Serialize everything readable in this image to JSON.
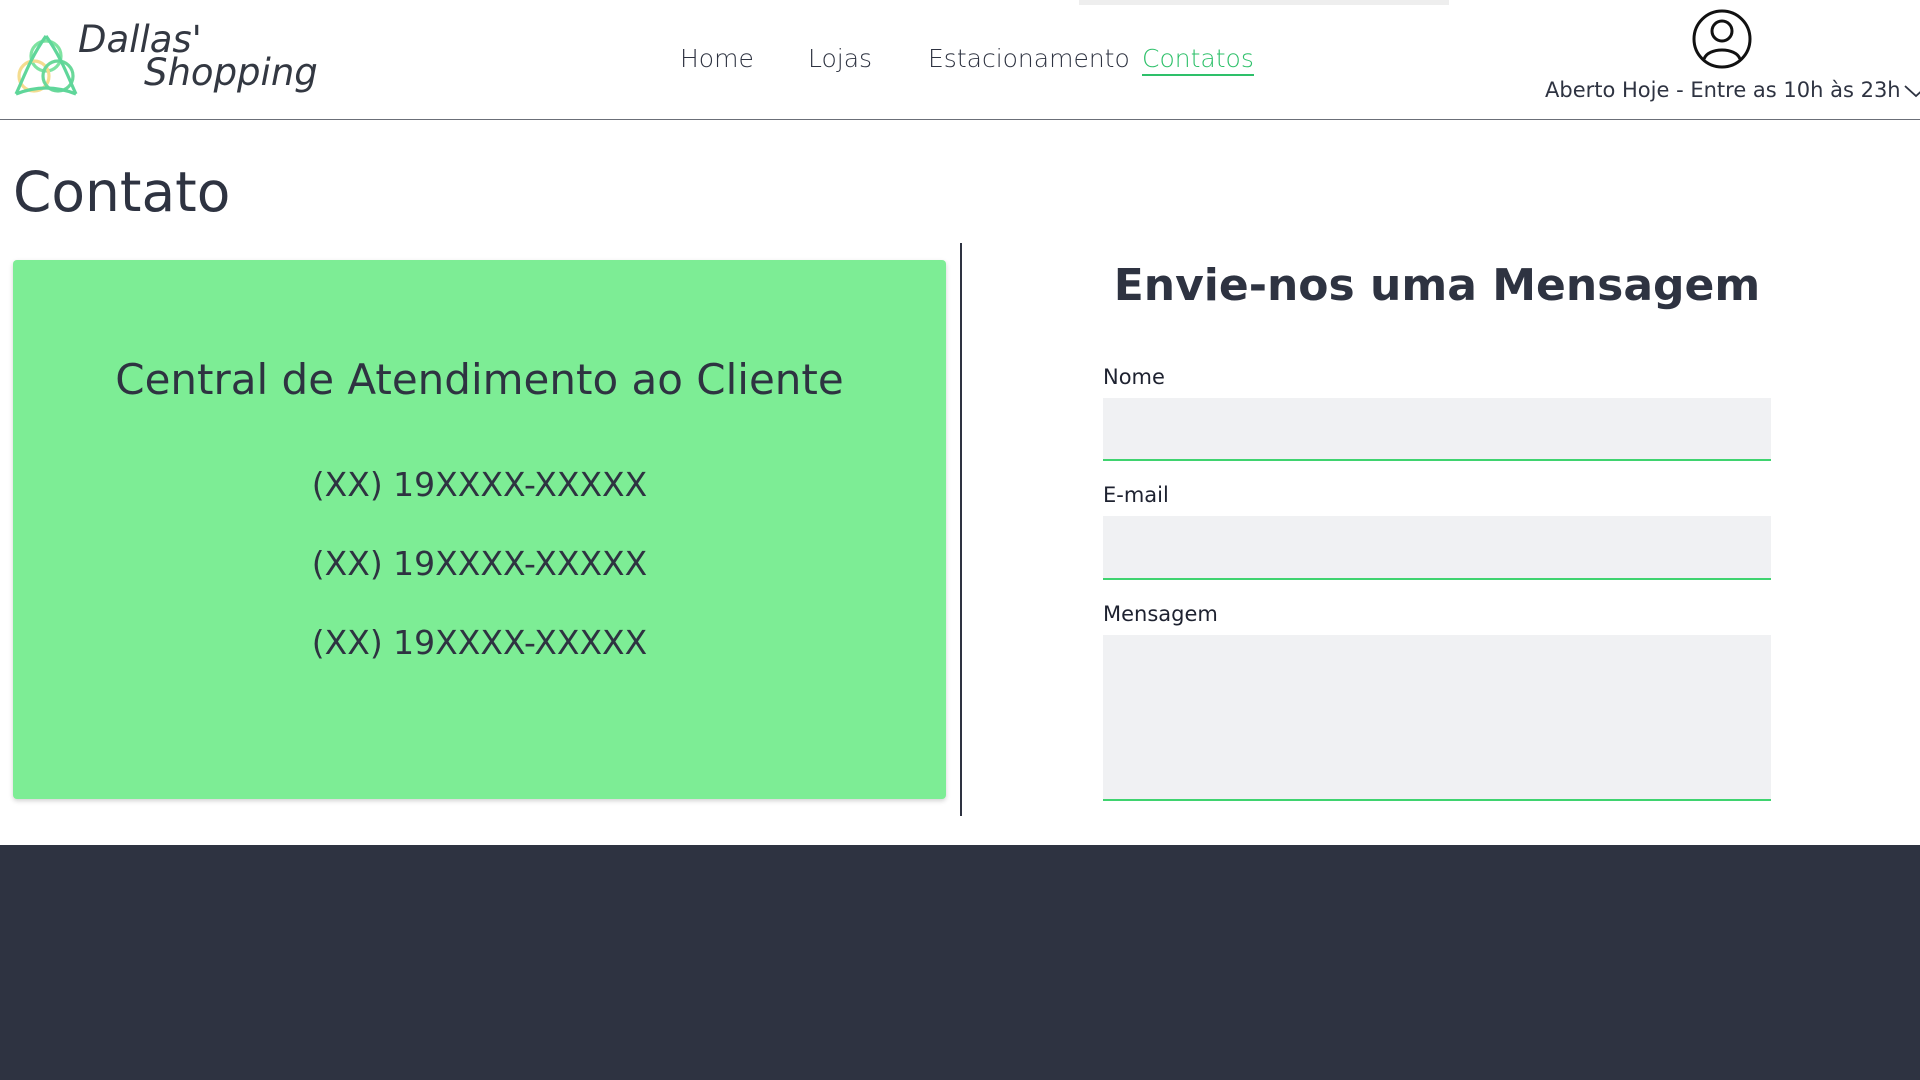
{
  "brand": {
    "line1": "Dallas'",
    "line2": "Shopping",
    "logo_icon": "triquetra-icon"
  },
  "nav": {
    "items": [
      {
        "label": "Home",
        "active": false
      },
      {
        "label": "Lojas",
        "active": false
      },
      {
        "label": "Estacionamento",
        "active": false
      },
      {
        "label": "Contatos",
        "active": true
      }
    ]
  },
  "user": {
    "icon": "user-circle-icon",
    "hours_text": "Aberto Hoje - Entre as 10h às 23h",
    "hours_chevron": "chevron-down-icon"
  },
  "page": {
    "title": "Contato"
  },
  "support": {
    "title": "Central de Atendimento ao Cliente",
    "phones": [
      "(XX) 19XXXX-XXXXX",
      "(XX) 19XXXX-XXXXX",
      "(XX) 19XXXX-XXXXX"
    ]
  },
  "form": {
    "title": "Envie-nos uma Mensagem",
    "name_label": "Nome",
    "name_value": "",
    "email_label": "E-mail",
    "email_value": "",
    "message_label": "Mensagem",
    "message_value": ""
  },
  "colors": {
    "accent": "#2ec06a",
    "card": "#7ded95",
    "text": "#2e3341",
    "footer": "#2e3341",
    "field_bg": "#f0f1f3"
  }
}
